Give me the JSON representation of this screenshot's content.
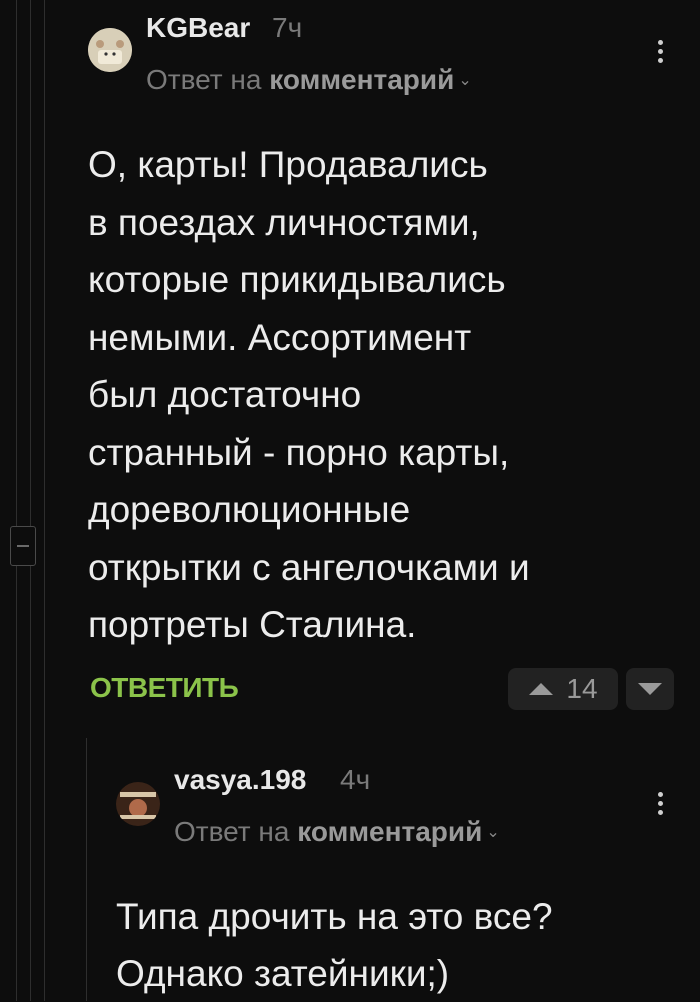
{
  "comment1": {
    "username": "KGBear",
    "time": "7ч",
    "reply_prefix": "Ответ на",
    "reply_target": "комментарий",
    "body_lines": [
      "О, карты! Продавались",
      "в поездах личностями,",
      "которые прикидывались",
      "немыми. Ассортимент",
      "был достаточно",
      "странный - порно карты,",
      "дореволюционные",
      "открытки с ангелочками и",
      "портреты Сталина."
    ],
    "reply_label": "ОТВЕТИТЬ",
    "rating": "14"
  },
  "comment2": {
    "username": "vasya.198",
    "time": "4ч",
    "reply_prefix": "Ответ на",
    "reply_target": "комментарий",
    "body_lines": [
      "Типа дрочить на это все?",
      "Однако затейники;)"
    ]
  },
  "colors": {
    "background": "#0d0d0d",
    "accent_reply": "#8bc34a",
    "text": "#ececec",
    "muted": "#7a7a7a"
  }
}
